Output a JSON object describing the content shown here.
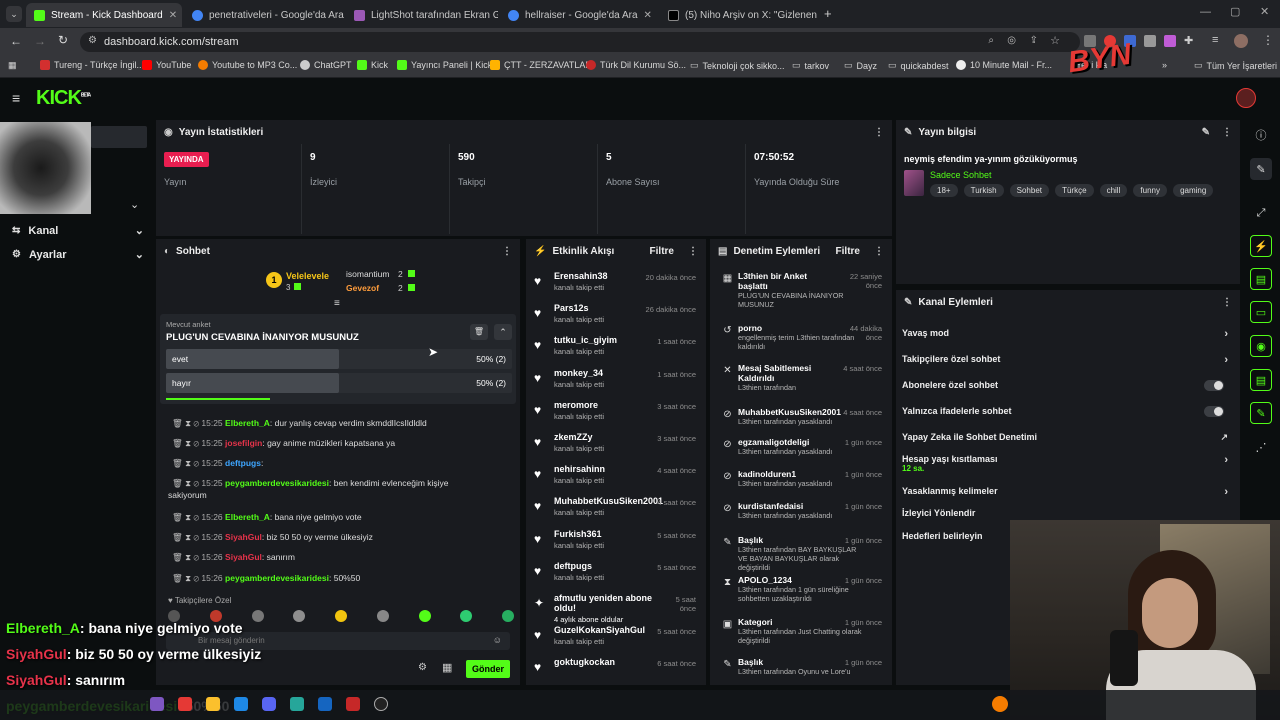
{
  "browser": {
    "tabs": [
      {
        "title": "Stream - Kick Dashboard",
        "color": "#53fc18"
      },
      {
        "title": "penetrativeleri - Google'da Ara",
        "color": "#4285f4"
      },
      {
        "title": "LightShot tarafından Ekran Gö",
        "color": "#9b59b6"
      },
      {
        "title": "hellraiser - Google'da Ara",
        "color": "#4285f4"
      },
      {
        "title": "(5) Niho Arşiv on X: \"Gizlenen a",
        "color": "#ffffff"
      }
    ],
    "url": "dashboard.kick.com/stream",
    "bookmarks": [
      "Tureng - Türkçe İngil...",
      "YouTube",
      "Youtube to MP3 Co...",
      "ChatGPT",
      "Kick",
      "Yayıncı Paneli | Kick",
      "ÇTT - ZERZAVATLAR",
      "Türk Dil Kurumu Sö...",
      "Teknoloji çok sikko...",
      "tarkov",
      "Dayz",
      "quickabdest",
      "10 Minute Mail - Fr...",
      "Yeni kla",
      "Tüm Yer İşaretleri"
    ],
    "overlay_logo": "BYN"
  },
  "kick": {
    "logo": "KICK",
    "logo_sup": "BETA",
    "nav": [
      {
        "label": "Kanal"
      },
      {
        "label": "Ayarlar"
      }
    ],
    "stats": {
      "title": "Yayın İstatistikleri",
      "live_badge": "YAYINDA",
      "items": [
        {
          "value": "",
          "label": "Yayın"
        },
        {
          "value": "9",
          "label": "İzleyici"
        },
        {
          "value": "590",
          "label": "Takipçi"
        },
        {
          "value": "5",
          "label": "Abone Sayısı"
        },
        {
          "value": "07:50:52",
          "label": "Yayında Olduğu Süre"
        }
      ]
    },
    "stream_info": {
      "title": "Yayın bilgisi",
      "stream_title": "neymiş efendim ya-yınım gözüküyormuş",
      "category": "Sadece Sohbet",
      "tags": [
        "18+",
        "Turkish",
        "Sohbet",
        "Türkçe",
        "chill",
        "funny",
        "gaming"
      ]
    },
    "chat": {
      "title": "Sohbet",
      "gifters": [
        {
          "name": "Velelevele",
          "count": "3"
        },
        {
          "name": "isomantium",
          "count": "2"
        },
        {
          "name": "Gevezof",
          "count": "2"
        }
      ],
      "poll": {
        "header": "Mevcut anket",
        "question": "PLUG'UN CEVABINA İNANIYOR MUSUNUZ",
        "options": [
          {
            "label": "evet",
            "result": "50% (2)",
            "fraction": 0.5
          },
          {
            "label": "hayır",
            "result": "50% (2)",
            "fraction": 0.5
          }
        ]
      },
      "messages": [
        {
          "time": "15:25",
          "user": "Elbereth_A",
          "text": ": dur yanlış cevap verdim skmddlIcsIldldld",
          "color": "#53fc18"
        },
        {
          "time": "15:25",
          "user": "josefilgin",
          "text": ": gay anime müzikleri kapatsana ya",
          "color": "#e6334a"
        },
        {
          "time": "15:25",
          "user": "deftpugs",
          "text": ":",
          "color": "#3ea6ff"
        },
        {
          "time": "15:25",
          "user": "peygamberdevesikaridesi",
          "text": ": ben kendimi evlenceğim kişiye",
          "color": "#53fc18"
        },
        {
          "time": "",
          "user": "",
          "text": "sakiyorum",
          "color": "#ddd"
        },
        {
          "time": "15:26",
          "user": "Elbereth_A",
          "text": ": bana niye gelmiyo vote",
          "color": "#53fc18"
        },
        {
          "time": "15:26",
          "user": "SiyahGul",
          "text": ": biz 50 50 oy verme ülkesiyiz",
          "color": "#e6334a"
        },
        {
          "time": "15:26",
          "user": "SiyahGul",
          "text": ": sanırım",
          "color": "#e6334a"
        },
        {
          "time": "15:26",
          "user": "peygamberdevesikaridesi",
          "text": ": 50%50",
          "color": "#53fc18"
        }
      ],
      "followers_only": "Takipçilere Özel",
      "input_placeholder": "Bir mesaj gönderin",
      "send": "Gönder"
    },
    "activity": {
      "title": "Etkinlik Akışı",
      "filter": "Filtre",
      "items": [
        {
          "name": "Erensahin38",
          "sub": "kanalı takip etti",
          "time": "20 dakika önce"
        },
        {
          "name": "Pars12s",
          "sub": "kanalı takip etti",
          "time": "26 dakika önce"
        },
        {
          "name": "tutku_ic_giyim",
          "sub": "kanalı takip etti",
          "time": "1 saat önce"
        },
        {
          "name": "monkey_34",
          "sub": "kanalı takip etti",
          "time": "1 saat önce"
        },
        {
          "name": "meromore",
          "sub": "kanalı takip etti",
          "time": "3 saat önce"
        },
        {
          "name": "zkemZZy",
          "sub": "kanalı takip etti",
          "time": "3 saat önce"
        },
        {
          "name": "nehirsahinn",
          "sub": "kanalı takip etti",
          "time": "4 saat önce"
        },
        {
          "name": "MuhabbetKusuSiken2001",
          "sub": "kanalı takip etti",
          "time": "4 saat önce"
        },
        {
          "name": "Furkish361",
          "sub": "kanalı takip etti",
          "time": "5 saat önce"
        },
        {
          "name": "deftpugs",
          "sub": "kanalı takip etti",
          "time": "5 saat önce"
        },
        {
          "name": "afmutlu yeniden abone oldu!",
          "sub": "4 aylık abone oldular",
          "time": "5 saat önce"
        },
        {
          "name": "GuzelKokanSiyahGul",
          "sub": "kanalı takip etti",
          "time": "5 saat önce"
        },
        {
          "name": "goktugkockan",
          "sub": "",
          "time": "6 saat önce"
        }
      ]
    },
    "moderation": {
      "title": "Denetim Eylemleri",
      "filter": "Filtre",
      "items": [
        {
          "icon": "▦",
          "name": "L3thien bir Anket başlattı",
          "sub": "PLUG'UN CEVABINA İNANIYOR MUSUNUZ",
          "time": "22 saniye önce"
        },
        {
          "icon": "↺",
          "name": "porno",
          "sub": "engellenmiş terim L3thien tarafından kaldırıldı",
          "time": "44 dakika önce"
        },
        {
          "icon": "✕",
          "name": "Mesaj Sabitlemesi Kaldırıldı",
          "sub": "L3thien tarafından",
          "time": "4 saat önce"
        },
        {
          "icon": "⊘",
          "name": "MuhabbetKusuSiken2001",
          "sub": "L3thien tarafından yasaklandı",
          "time": "4 saat önce"
        },
        {
          "icon": "⊘",
          "name": "egzamaligotdeligi",
          "sub": "L3thien tarafından yasaklandı",
          "time": "1 gün önce"
        },
        {
          "icon": "⊘",
          "name": "kadinolduren1",
          "sub": "L3thien tarafından yasaklandı",
          "time": "1 gün önce"
        },
        {
          "icon": "⊘",
          "name": "kurdistanfedaisi",
          "sub": "L3thien tarafından yasaklandı",
          "time": "1 gün önce"
        },
        {
          "icon": "✎",
          "name": "Başlık",
          "sub": "L3thien tarafından BAY BAYKUŞLAR VE BAYAN BAYKUŞLAR olarak değiştirildi",
          "time": "1 gün önce"
        },
        {
          "icon": "⧗",
          "name": "APOLO_1234",
          "sub": "L3thien tarafından 1 gün süreliğine sohbetten uzaklaştırıldı",
          "time": "1 gün önce"
        },
        {
          "icon": "▣",
          "name": "Kategori",
          "sub": "L3thien tarafından Just Chatting olarak değiştirildi",
          "time": "1 gün önce"
        },
        {
          "icon": "✎",
          "name": "Başlık",
          "sub": "L3thien tarafından Oyunu ve Lore'u",
          "time": "1 gün önce"
        }
      ]
    },
    "channel_actions": {
      "title": "Kanal Eylemleri",
      "items": [
        {
          "label": "Yavaş mod",
          "kind": "chev"
        },
        {
          "label": "Takipçilere özel sohbet",
          "kind": "chev"
        },
        {
          "label": "Abonelere özel sohbet",
          "kind": "toggle"
        },
        {
          "label": "Yalnızca ifadelerle sohbet",
          "kind": "toggle"
        },
        {
          "label": "Yapay Zeka ile Sohbet Denetimi",
          "kind": "ext"
        },
        {
          "label": "Hesap yaşı kısıtlaması",
          "kind": "chev",
          "sub": "12 sa."
        },
        {
          "label": "Yasaklanmış kelimeler",
          "kind": "chev"
        },
        {
          "label": "İzleyici Yönlendir",
          "kind": "none"
        },
        {
          "label": "Hedefleri belirleyin",
          "kind": "none"
        }
      ]
    }
  },
  "overlay_chat": [
    {
      "user": "Elbereth_A",
      "text": ": bana niye gelmiyo vote",
      "color": "#53fc18"
    },
    {
      "user": "SiyahGul",
      "text": ": biz 50 50 oy verme ülkesiyiz",
      "color": "#e6334a"
    },
    {
      "user": "SiyahGul",
      "text": ": sanırım",
      "color": "#e6334a"
    },
    {
      "user": "peygamberdevesikaridesi",
      "text": ": 50%50",
      "color": "#53fc18"
    }
  ]
}
